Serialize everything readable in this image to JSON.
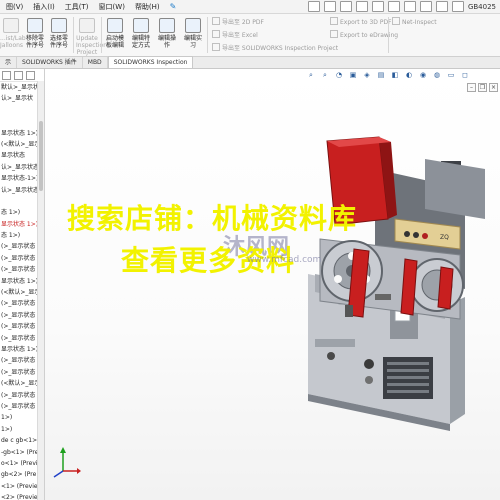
{
  "menubar": {
    "items": [
      "图(V)",
      "插入(I)",
      "工具(T)",
      "窗口(W)",
      "帮助(H)"
    ],
    "document_title": "GB4025"
  },
  "ribbon": {
    "buttons": [
      {
        "label": "...ist/Lab\nJalloons",
        "enabled": false
      },
      {
        "label": "移除零\n件序号",
        "enabled": true
      },
      {
        "label": "选择零\n件序号",
        "enabled": true
      },
      {
        "label": "Update\nInspection\nProject",
        "enabled": false
      },
      {
        "label": "启动模\n板编辑",
        "enabled": true
      },
      {
        "label": "编辑特\n定方式",
        "enabled": true
      },
      {
        "label": "编辑操\n作",
        "enabled": true
      },
      {
        "label": "编辑实\n习",
        "enabled": true
      }
    ],
    "export": {
      "pdf2d": "导出至 2D PDF",
      "excel": "导出至 Excel",
      "sw_inspection": "导出至 SOLIDWORKS Inspection Project",
      "pdf3d": "Export to 3D PDF",
      "edrawing": "Export to eDrawing",
      "net_inspect": "Net-Inspect"
    }
  },
  "tabs": [
    "示",
    "SOLIDWORKS 插件",
    "MBD",
    "SOLIDWORKS Inspection"
  ],
  "active_tab_index": 3,
  "tree": {
    "rows": [
      {
        "text": "默认>_显示状",
        "red": false
      },
      {
        "text": "认>_显示状",
        "red": false
      },
      {
        "text": "",
        "red": false
      },
      {
        "text": "",
        "red": false
      },
      {
        "text": "显示状态 1>)",
        "red": false
      },
      {
        "text": "(<默认>_显示状态",
        "red": false
      },
      {
        "text": "显示状态",
        "red": false
      },
      {
        "text": "认>_显示状态",
        "red": false
      },
      {
        "text": "显示状态-1>)",
        "red": false
      },
      {
        "text": "认>_显示状态",
        "red": false
      },
      {
        "text": "",
        "red": false
      },
      {
        "text": "态 1>)",
        "red": false
      },
      {
        "text": "显示状态 1>)",
        "red": true
      },
      {
        "text": "态 1>)",
        "red": false
      },
      {
        "text": "(>_显示状态 1",
        "red": false
      },
      {
        "text": "(>_显示状态 1",
        "red": false
      },
      {
        "text": "(>_显示状态 1",
        "red": false
      },
      {
        "text": "显示状态 1>)",
        "red": false
      },
      {
        "text": "(<默认>_显示状态",
        "red": false
      },
      {
        "text": "(>_显示状态 1",
        "red": false
      },
      {
        "text": "(>_显示状态 1",
        "red": false
      },
      {
        "text": "(>_显示状态 1",
        "red": false
      },
      {
        "text": "(>_显示状态 1",
        "red": false
      },
      {
        "text": "显示状态 1>)",
        "red": false
      },
      {
        "text": "(>_显示状态 1",
        "red": false
      },
      {
        "text": "(>_显示状态 1",
        "red": false
      },
      {
        "text": "(<默认>_显示状态",
        "red": false
      },
      {
        "text": "(>_显示状态 1",
        "red": false
      },
      {
        "text": "(>_显示状态 1",
        "red": false
      },
      {
        "text": "1>)",
        "red": false
      },
      {
        "text": "1>)",
        "red": false
      },
      {
        "text": "de c gb<1>",
        "red": false
      },
      {
        "text": "-gb<1> (Pre",
        "red": false
      },
      {
        "text": "o<1> (Previ",
        "red": false
      },
      {
        "text": "gb<2> (Pre",
        "red": false
      },
      {
        "text": "<1> (Previe",
        "red": false
      },
      {
        "text": "<2> (Previe",
        "red": false
      }
    ]
  },
  "watermark": {
    "line1": "搜索店铺：机械资料库",
    "line2": "查看更多资料",
    "logo_text": "沐风网",
    "logo_url": "www.mfcad.com"
  },
  "model": {
    "panel_text": "ZQ",
    "body_color": "#b9bcc4",
    "guard_color": "#c81f1f",
    "frame_color": "#8f959e"
  },
  "colors": {
    "watermark_yellow": "#f2f200",
    "accent_blue": "#1c7ac8"
  }
}
